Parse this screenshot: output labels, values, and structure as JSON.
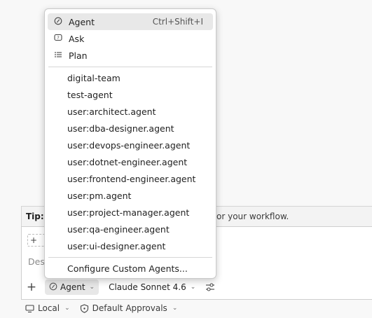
{
  "tip": {
    "label": "Tip: ",
    "text_tail": "or your workflow."
  },
  "chat": {
    "context_chip": "+ ",
    "input_placeholder": "Des"
  },
  "toolbar": {
    "add_label": "+",
    "mode_label": "Agent",
    "model_label": "Claude Sonnet 4.6"
  },
  "status": {
    "location_label": "Local",
    "approvals_label": "Default Approvals"
  },
  "menu": {
    "modes": [
      {
        "label": "Agent",
        "shortcut": "Ctrl+Shift+I",
        "icon": "agent-icon",
        "selected": true
      },
      {
        "label": "Ask",
        "shortcut": "",
        "icon": "chat-icon",
        "selected": false
      },
      {
        "label": "Plan",
        "shortcut": "",
        "icon": "list-icon",
        "selected": false
      }
    ],
    "agents": [
      "digital-team",
      "test-agent",
      "user:architect.agent",
      "user:dba-designer.agent",
      "user:devops-engineer.agent",
      "user:dotnet-engineer.agent",
      "user:frontend-engineer.agent",
      "user:pm.agent",
      "user:project-manager.agent",
      "user:qa-engineer.agent",
      "user:ui-designer.agent"
    ],
    "configure_label": "Configure Custom Agents..."
  }
}
